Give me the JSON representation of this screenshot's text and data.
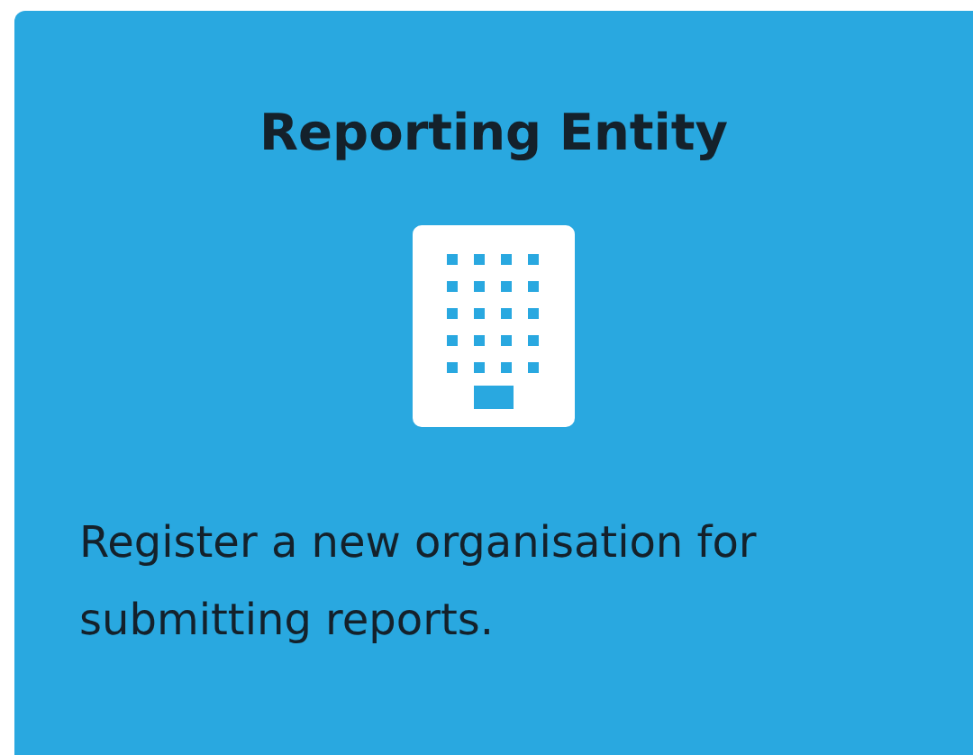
{
  "card": {
    "title": "Reporting Entity",
    "description": "Register a new organisation for submitting reports."
  }
}
